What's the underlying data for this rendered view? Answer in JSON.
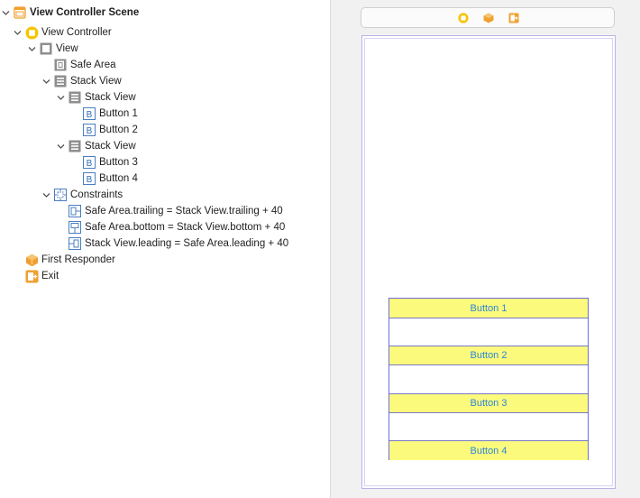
{
  "outline": {
    "scene": {
      "label": "View Controller Scene",
      "icon": "scene-icon"
    },
    "view_controller": {
      "label": "View Controller",
      "icon": "view-controller-icon"
    },
    "view": {
      "label": "View",
      "icon": "view-icon"
    },
    "safe_area": {
      "label": "Safe Area",
      "icon": "safe-area-icon"
    },
    "outer_stack": {
      "label": "Stack View",
      "icon": "stack-view-icon"
    },
    "stack_1": {
      "label": "Stack View",
      "icon": "stack-view-icon"
    },
    "button_1": {
      "label": "Button 1",
      "icon": "button-icon"
    },
    "button_2": {
      "label": "Button 2",
      "icon": "button-icon"
    },
    "stack_2": {
      "label": "Stack View",
      "icon": "stack-view-icon"
    },
    "button_3": {
      "label": "Button 3",
      "icon": "button-icon"
    },
    "button_4": {
      "label": "Button 4",
      "icon": "button-icon"
    },
    "constraints": {
      "label": "Constraints",
      "icon": "constraints-icon"
    },
    "constraint_1": {
      "label": "Safe Area.trailing = Stack View.trailing + 40",
      "icon": "constraint-trailing-icon"
    },
    "constraint_2": {
      "label": "Safe Area.bottom = Stack View.bottom + 40",
      "icon": "constraint-bottom-icon"
    },
    "constraint_3": {
      "label": "Stack View.leading = Safe Area.leading + 40",
      "icon": "constraint-leading-icon"
    },
    "first_responder": {
      "label": "First Responder",
      "icon": "first-responder-icon"
    },
    "exit": {
      "label": "Exit",
      "icon": "exit-icon"
    }
  },
  "canvas": {
    "dock_icons": [
      "view-controller-icon",
      "first-responder-icon",
      "exit-icon"
    ],
    "buttons": [
      "Button 1",
      "Button 2",
      "Button 3",
      "Button 4"
    ]
  },
  "colors": {
    "button_fill": "#fbfa7c",
    "button_text": "#2f86d6",
    "stack_border": "#6d6de0",
    "accent_orange": "#f0a030",
    "accent_yellow": "#f5c400"
  }
}
